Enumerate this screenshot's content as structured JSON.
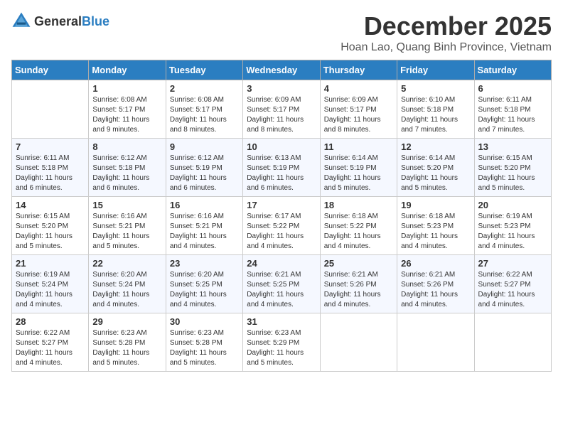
{
  "header": {
    "logo_general": "General",
    "logo_blue": "Blue",
    "month_title": "December 2025",
    "subtitle": "Hoan Lao, Quang Binh Province, Vietnam"
  },
  "days_of_week": [
    "Sunday",
    "Monday",
    "Tuesday",
    "Wednesday",
    "Thursday",
    "Friday",
    "Saturday"
  ],
  "weeks": [
    [
      {
        "day": "",
        "sunrise": "",
        "sunset": "",
        "daylight": ""
      },
      {
        "day": "1",
        "sunrise": "Sunrise: 6:08 AM",
        "sunset": "Sunset: 5:17 PM",
        "daylight": "Daylight: 11 hours and 9 minutes."
      },
      {
        "day": "2",
        "sunrise": "Sunrise: 6:08 AM",
        "sunset": "Sunset: 5:17 PM",
        "daylight": "Daylight: 11 hours and 8 minutes."
      },
      {
        "day": "3",
        "sunrise": "Sunrise: 6:09 AM",
        "sunset": "Sunset: 5:17 PM",
        "daylight": "Daylight: 11 hours and 8 minutes."
      },
      {
        "day": "4",
        "sunrise": "Sunrise: 6:09 AM",
        "sunset": "Sunset: 5:17 PM",
        "daylight": "Daylight: 11 hours and 8 minutes."
      },
      {
        "day": "5",
        "sunrise": "Sunrise: 6:10 AM",
        "sunset": "Sunset: 5:18 PM",
        "daylight": "Daylight: 11 hours and 7 minutes."
      },
      {
        "day": "6",
        "sunrise": "Sunrise: 6:11 AM",
        "sunset": "Sunset: 5:18 PM",
        "daylight": "Daylight: 11 hours and 7 minutes."
      }
    ],
    [
      {
        "day": "7",
        "sunrise": "Sunrise: 6:11 AM",
        "sunset": "Sunset: 5:18 PM",
        "daylight": "Daylight: 11 hours and 6 minutes."
      },
      {
        "day": "8",
        "sunrise": "Sunrise: 6:12 AM",
        "sunset": "Sunset: 5:18 PM",
        "daylight": "Daylight: 11 hours and 6 minutes."
      },
      {
        "day": "9",
        "sunrise": "Sunrise: 6:12 AM",
        "sunset": "Sunset: 5:19 PM",
        "daylight": "Daylight: 11 hours and 6 minutes."
      },
      {
        "day": "10",
        "sunrise": "Sunrise: 6:13 AM",
        "sunset": "Sunset: 5:19 PM",
        "daylight": "Daylight: 11 hours and 6 minutes."
      },
      {
        "day": "11",
        "sunrise": "Sunrise: 6:14 AM",
        "sunset": "Sunset: 5:19 PM",
        "daylight": "Daylight: 11 hours and 5 minutes."
      },
      {
        "day": "12",
        "sunrise": "Sunrise: 6:14 AM",
        "sunset": "Sunset: 5:20 PM",
        "daylight": "Daylight: 11 hours and 5 minutes."
      },
      {
        "day": "13",
        "sunrise": "Sunrise: 6:15 AM",
        "sunset": "Sunset: 5:20 PM",
        "daylight": "Daylight: 11 hours and 5 minutes."
      }
    ],
    [
      {
        "day": "14",
        "sunrise": "Sunrise: 6:15 AM",
        "sunset": "Sunset: 5:20 PM",
        "daylight": "Daylight: 11 hours and 5 minutes."
      },
      {
        "day": "15",
        "sunrise": "Sunrise: 6:16 AM",
        "sunset": "Sunset: 5:21 PM",
        "daylight": "Daylight: 11 hours and 5 minutes."
      },
      {
        "day": "16",
        "sunrise": "Sunrise: 6:16 AM",
        "sunset": "Sunset: 5:21 PM",
        "daylight": "Daylight: 11 hours and 4 minutes."
      },
      {
        "day": "17",
        "sunrise": "Sunrise: 6:17 AM",
        "sunset": "Sunset: 5:22 PM",
        "daylight": "Daylight: 11 hours and 4 minutes."
      },
      {
        "day": "18",
        "sunrise": "Sunrise: 6:18 AM",
        "sunset": "Sunset: 5:22 PM",
        "daylight": "Daylight: 11 hours and 4 minutes."
      },
      {
        "day": "19",
        "sunrise": "Sunrise: 6:18 AM",
        "sunset": "Sunset: 5:23 PM",
        "daylight": "Daylight: 11 hours and 4 minutes."
      },
      {
        "day": "20",
        "sunrise": "Sunrise: 6:19 AM",
        "sunset": "Sunset: 5:23 PM",
        "daylight": "Daylight: 11 hours and 4 minutes."
      }
    ],
    [
      {
        "day": "21",
        "sunrise": "Sunrise: 6:19 AM",
        "sunset": "Sunset: 5:24 PM",
        "daylight": "Daylight: 11 hours and 4 minutes."
      },
      {
        "day": "22",
        "sunrise": "Sunrise: 6:20 AM",
        "sunset": "Sunset: 5:24 PM",
        "daylight": "Daylight: 11 hours and 4 minutes."
      },
      {
        "day": "23",
        "sunrise": "Sunrise: 6:20 AM",
        "sunset": "Sunset: 5:25 PM",
        "daylight": "Daylight: 11 hours and 4 minutes."
      },
      {
        "day": "24",
        "sunrise": "Sunrise: 6:21 AM",
        "sunset": "Sunset: 5:25 PM",
        "daylight": "Daylight: 11 hours and 4 minutes."
      },
      {
        "day": "25",
        "sunrise": "Sunrise: 6:21 AM",
        "sunset": "Sunset: 5:26 PM",
        "daylight": "Daylight: 11 hours and 4 minutes."
      },
      {
        "day": "26",
        "sunrise": "Sunrise: 6:21 AM",
        "sunset": "Sunset: 5:26 PM",
        "daylight": "Daylight: 11 hours and 4 minutes."
      },
      {
        "day": "27",
        "sunrise": "Sunrise: 6:22 AM",
        "sunset": "Sunset: 5:27 PM",
        "daylight": "Daylight: 11 hours and 4 minutes."
      }
    ],
    [
      {
        "day": "28",
        "sunrise": "Sunrise: 6:22 AM",
        "sunset": "Sunset: 5:27 PM",
        "daylight": "Daylight: 11 hours and 4 minutes."
      },
      {
        "day": "29",
        "sunrise": "Sunrise: 6:23 AM",
        "sunset": "Sunset: 5:28 PM",
        "daylight": "Daylight: 11 hours and 5 minutes."
      },
      {
        "day": "30",
        "sunrise": "Sunrise: 6:23 AM",
        "sunset": "Sunset: 5:28 PM",
        "daylight": "Daylight: 11 hours and 5 minutes."
      },
      {
        "day": "31",
        "sunrise": "Sunrise: 6:23 AM",
        "sunset": "Sunset: 5:29 PM",
        "daylight": "Daylight: 11 hours and 5 minutes."
      },
      {
        "day": "",
        "sunrise": "",
        "sunset": "",
        "daylight": ""
      },
      {
        "day": "",
        "sunrise": "",
        "sunset": "",
        "daylight": ""
      },
      {
        "day": "",
        "sunrise": "",
        "sunset": "",
        "daylight": ""
      }
    ]
  ]
}
